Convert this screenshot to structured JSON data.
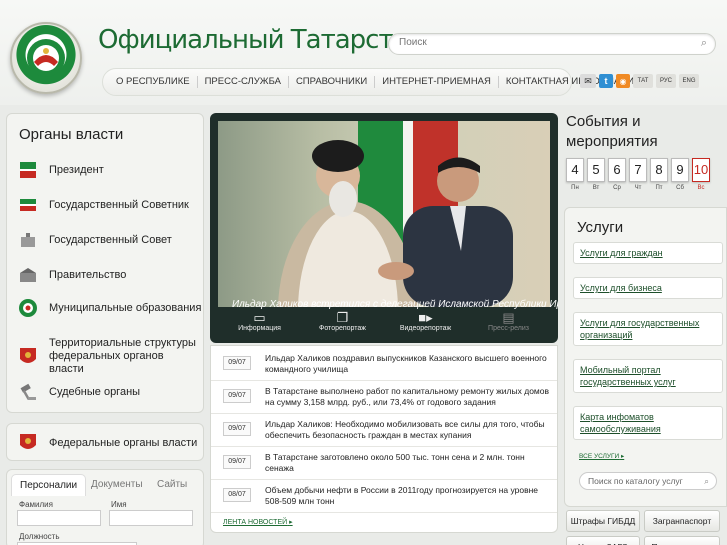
{
  "header": {
    "title": "Официальный Татарстан",
    "search_placeholder": "Поиск",
    "nav": [
      "О РЕСПУБЛИКЕ",
      "ПРЕСС-СЛУЖБА",
      "СПРАВОЧНИКИ",
      "ИНТЕРНЕТ-ПРИЕМНАЯ",
      "КОНТАКТНАЯ ИНФОРМАЦИЯ"
    ],
    "lang": [
      "ТАТ",
      "РУС",
      "ENG"
    ]
  },
  "gov": {
    "title": "Органы власти",
    "items": [
      "Президент",
      "Государственный Советник",
      "Государственный Совет",
      "Правительство",
      "Муниципальные образования",
      "Территориальные структуры федеральных органов власти",
      "Судебные органы"
    ],
    "federal": "Федеральные органы власти"
  },
  "tabs": {
    "items": [
      "Персоналии",
      "Документы",
      "Сайты"
    ],
    "fields": [
      "Фамилия",
      "Имя",
      "Должность"
    ]
  },
  "slider": {
    "caption": "Ильдар Халиков встретился с делегацией Исламской Республики Иран",
    "media": [
      "Информация",
      "Фоторепортаж",
      "Видеорепортаж",
      "Пресс-релиз"
    ]
  },
  "news": {
    "items": [
      {
        "date": "09/07",
        "text": "Ильдар Халиков поздравил выпускников Казанского высшего военного командного училища"
      },
      {
        "date": "09/07",
        "text": "В Татарстане выполнено работ по капитальному ремонту жилых домов на сумму 3,158 млрд. руб., или 73,4% от годового задания"
      },
      {
        "date": "09/07",
        "text": "Ильдар Халиков: Необходимо мобилизовать все силы для того, чтобы обеспечить безопасность граждан в местах купания"
      },
      {
        "date": "09/07",
        "text": "В Татарстане заготовлено около 500 тыс. тонн сена и 2 млн. тонн сенажа"
      },
      {
        "date": "08/07",
        "text": "Объем добычи нефти в России в 2011году прогнозируется на уровне 508-509 млн тонн"
      }
    ],
    "feed_link": "ЛЕНТА НОВОСТЕЙ"
  },
  "events": {
    "title": "События и мероприятия",
    "days": [
      {
        "num": "4",
        "name": "Пн"
      },
      {
        "num": "5",
        "name": "Вт"
      },
      {
        "num": "6",
        "name": "Ср"
      },
      {
        "num": "7",
        "name": "Чт"
      },
      {
        "num": "8",
        "name": "Пт"
      },
      {
        "num": "9",
        "name": "Сб"
      },
      {
        "num": "10",
        "name": "Вс"
      }
    ]
  },
  "services": {
    "title": "Услуги",
    "items": [
      "Услуги для граждан",
      "Услуги для бизнеса",
      "Услуги для государственных организаций",
      "Мобильный портал государственных услуг",
      "Карта инфоматов самообслуживания"
    ],
    "all_link": "ВСЕ УСЛУГИ",
    "search_placeholder": "Поиск по каталогу услуг"
  },
  "bottom": [
    "Штрафы ГИБДД",
    "Загранпаспорт",
    "Услуги ЗАГС",
    "Прием граждан"
  ],
  "colors": {
    "brand_green": "#1d6b33",
    "accent_red": "#c62a22"
  }
}
